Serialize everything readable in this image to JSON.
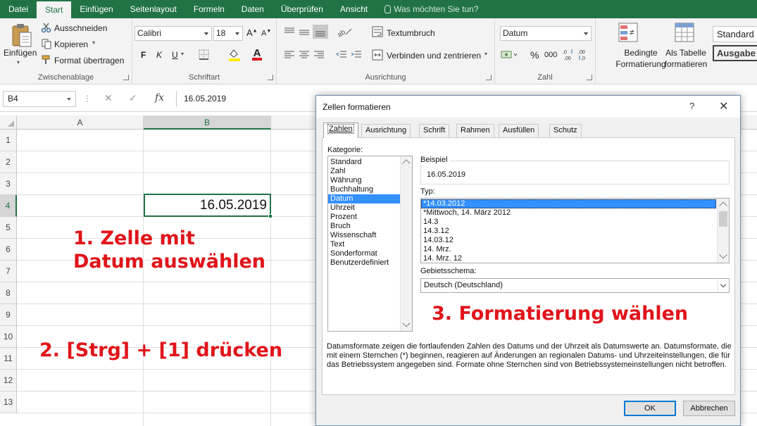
{
  "tabs": [
    {
      "label": "Datei"
    },
    {
      "label": "Start"
    },
    {
      "label": "Einfügen"
    },
    {
      "label": "Seitenlayout"
    },
    {
      "label": "Formeln"
    },
    {
      "label": "Daten"
    },
    {
      "label": "Überprüfen"
    },
    {
      "label": "Ansicht"
    }
  ],
  "help_search": "Was möchten Sie tun?",
  "ribbon": {
    "clipboard": {
      "label": "Zwischenablage",
      "paste": "Einfügen",
      "cut": "Ausschneiden",
      "copy": "Kopieren",
      "format_painter": "Format übertragen"
    },
    "font": {
      "label": "Schriftart",
      "font_name": "Calibri",
      "font_size": "18",
      "grow": "A",
      "shrink": "A",
      "bold": "F",
      "italic": "K",
      "underline": "U",
      "font_color_letter": "A"
    },
    "alignment": {
      "label": "Ausrichtung",
      "wrap": "Textumbruch",
      "merge": "Verbinden und zentrieren"
    },
    "number": {
      "label": "Zahl",
      "format": "Datum",
      "percent": "%",
      "thousands": "000"
    },
    "styles": {
      "conditional": "Bedingte Formatierung",
      "as_table": "Als Tabelle formatieren",
      "standard": "Standard",
      "output": "Ausgabe"
    }
  },
  "formula_bar": {
    "name_box": "B4",
    "fx": "fx",
    "value": "16.05.2019"
  },
  "grid": {
    "columns": [
      "A",
      "B"
    ],
    "rows": [
      "1",
      "2",
      "3",
      "4",
      "5",
      "6",
      "7",
      "8",
      "9",
      "10",
      "11",
      "12",
      "13"
    ],
    "cell_b4": "16.05.2019"
  },
  "annotations": {
    "step1_line1": "1. Zelle mit",
    "step1_line2": "Datum auswählen",
    "step2": "2. [Strg] + [1] drücken",
    "step3": "3. Formatierung wählen"
  },
  "dialog": {
    "title": "Zellen formatieren",
    "help": "?",
    "close": "✕",
    "tabs": [
      "Zahlen",
      "Ausrichtung",
      "Schrift",
      "Rahmen",
      "Ausfüllen",
      "Schutz"
    ],
    "category_label": "Kategorie:",
    "categories": [
      "Standard",
      "Zahl",
      "Währung",
      "Buchhaltung",
      "Datum",
      "Uhrzeit",
      "Prozent",
      "Bruch",
      "Wissenschaft",
      "Text",
      "Sonderformat",
      "Benutzerdefiniert"
    ],
    "sample_label": "Beispiel",
    "sample_value": "16.05.2019",
    "type_label": "Typ:",
    "types": [
      "*14.03.2012",
      "*Mittwoch, 14. März 2012",
      "14.3",
      "14.3.12",
      "14.03.12",
      "14. Mrz.",
      "14. Mrz. 12"
    ],
    "locale_label": "Gebietsschema:",
    "locale_value": "Deutsch (Deutschland)",
    "description": "Datumsformate zeigen die fortlaufenden Zahlen des Datums und der Uhrzeit als Datumswerte an. Datumsformate, die mit einem Sternchen (*) beginnen, reagieren auf Änderungen an regionalen Datums- und Uhrzeiteinstellungen, die für das Betriebssystem angegeben sind. Formate ohne Sternchen sind von Betriebssystemeinstellungen nicht betroffen.",
    "ok": "OK",
    "cancel": "Abbrechen"
  }
}
